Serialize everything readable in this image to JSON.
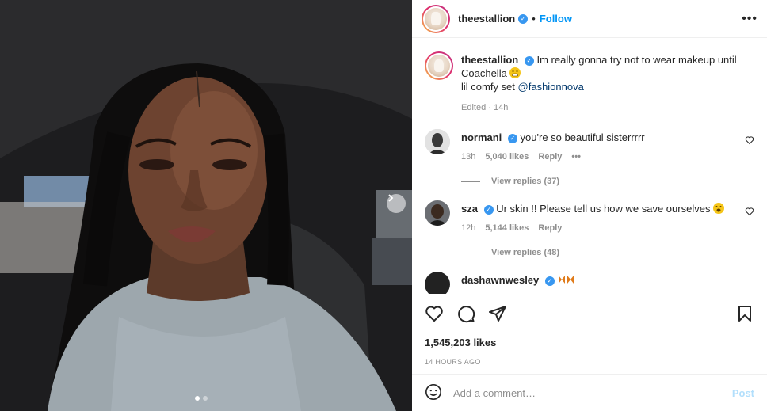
{
  "post": {
    "username": "theestallion",
    "follow_label": "Follow",
    "separator": "•",
    "more_label": "•••"
  },
  "caption": {
    "username": "theestallion",
    "text_line1": "Im really gonna try not to wear makeup until",
    "text_line2": "Coachella",
    "text_line3_prefix": "lil comfy set",
    "mention": "@fashionnova",
    "edited": "Edited",
    "edited_sep": "·",
    "time": "14h"
  },
  "comments": [
    {
      "username": "normani",
      "text": "you're so beautiful sisterrrrr",
      "time": "13h",
      "likes": "5,040 likes",
      "reply": "Reply",
      "more": "•••",
      "view_replies": "View replies (37)"
    },
    {
      "username": "sza",
      "text": "Ur skin !! Please tell us how we save ourselves",
      "time": "12h",
      "likes": "5,144 likes",
      "reply": "Reply",
      "view_replies": "View replies (48)"
    },
    {
      "username": "dashawnwesley"
    }
  ],
  "actions": {
    "likes": "1,545,203 likes",
    "time_ago": "14 HOURS AGO"
  },
  "add_comment": {
    "placeholder": "Add a comment…",
    "post_label": "Post"
  },
  "icons": {
    "like": "heart-icon",
    "comment": "comment-icon",
    "share": "share-icon",
    "save": "bookmark-icon",
    "emoji": "emoji-icon",
    "next": "chevron-right-icon"
  },
  "colors": {
    "accent": "#0095f6",
    "verified": "#3897f0",
    "meta": "#8e8e8e",
    "mention": "#00376b",
    "post_disabled": "#b2dffc"
  }
}
